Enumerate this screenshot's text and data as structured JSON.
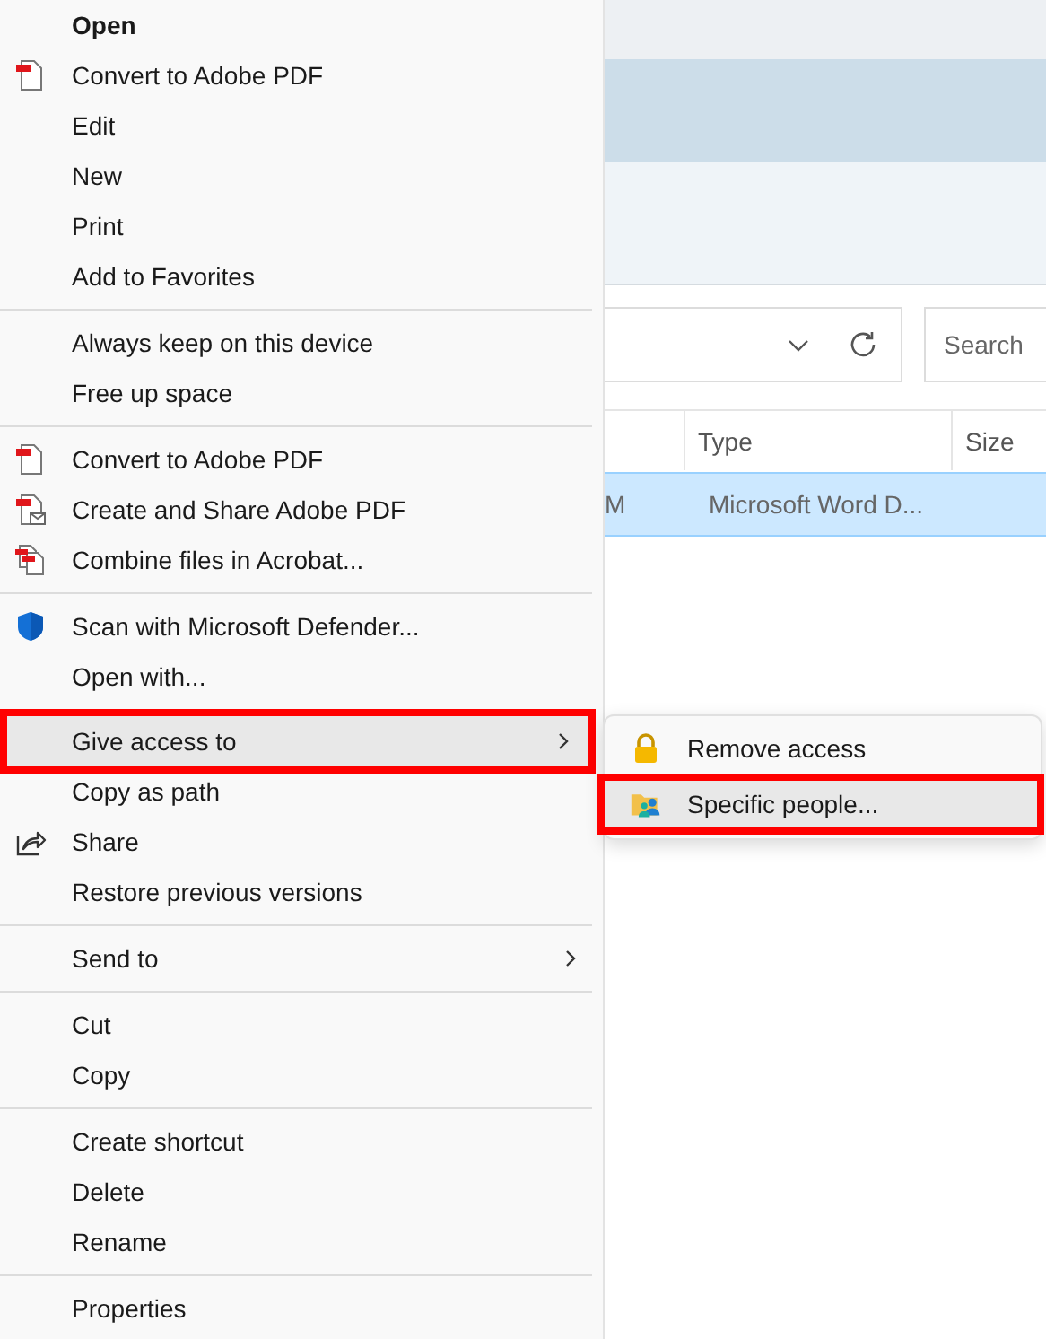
{
  "menu": {
    "sections": [
      {
        "items": [
          {
            "label": "Open",
            "bold": true
          },
          {
            "label": "Convert to Adobe PDF",
            "kind": "pdf"
          },
          {
            "label": "Edit"
          },
          {
            "label": "New"
          },
          {
            "label": "Print"
          },
          {
            "label": "Add to Favorites"
          }
        ]
      },
      {
        "items": [
          {
            "label": "Always keep on this device"
          },
          {
            "label": "Free up space"
          }
        ]
      },
      {
        "items": [
          {
            "label": "Convert to Adobe PDF",
            "kind": "pdf"
          },
          {
            "label": "Create and Share Adobe PDF",
            "kind": "pdf-mail"
          },
          {
            "label": "Combine files in Acrobat...",
            "kind": "pdf-stack"
          }
        ]
      },
      {
        "items": [
          {
            "label": "Scan with Microsoft Defender...",
            "kind": "shield"
          },
          {
            "label": "Open with..."
          },
          {
            "label": "Give access to",
            "has_submenu": true,
            "highlighted": true,
            "annotated": true
          },
          {
            "label": "Copy as path"
          },
          {
            "label": "Share",
            "kind": "share"
          },
          {
            "label": "Restore previous versions"
          }
        ]
      },
      {
        "items": [
          {
            "label": "Send to",
            "has_submenu": true
          }
        ]
      },
      {
        "items": [
          {
            "label": "Cut"
          },
          {
            "label": "Copy"
          }
        ]
      },
      {
        "items": [
          {
            "label": "Create shortcut"
          },
          {
            "label": "Delete"
          },
          {
            "label": "Rename"
          }
        ]
      },
      {
        "items": [
          {
            "label": "Properties"
          }
        ]
      }
    ]
  },
  "submenu": {
    "items": [
      {
        "label": "Remove access",
        "kind": "lock",
        "highlighted": false,
        "annotated": false
      },
      {
        "label": "Specific people...",
        "kind": "people",
        "highlighted": true,
        "annotated": true
      }
    ]
  },
  "explorer": {
    "search": {
      "placeholder": "Search"
    },
    "columns": [
      "",
      "Type",
      "Size"
    ],
    "rows": [
      {
        "cells": [
          "M",
          "Microsoft Word D..."
        ],
        "selected": true
      }
    ]
  }
}
